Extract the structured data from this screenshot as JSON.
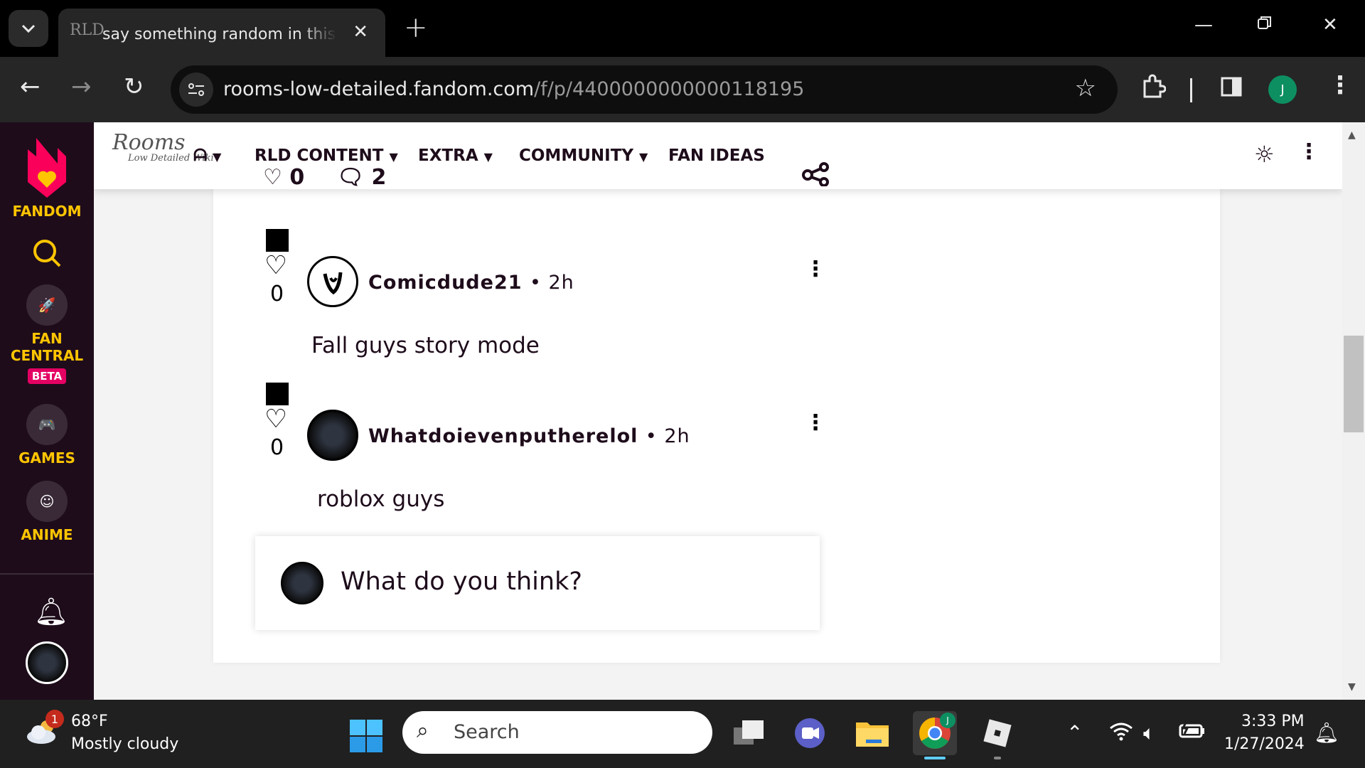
{
  "browser": {
    "tab_title": "say something random in this p",
    "tab_favicon": "RLD",
    "url_host": "rooms-low-detailed.fandom.com",
    "url_path": "/f/p/4400000000000118195",
    "profile_initial": "J"
  },
  "rail": {
    "fandom_label": "FANDOM",
    "fan_central_label_1": "FAN",
    "fan_central_label_2": "CENTRAL",
    "beta_label": "BETA",
    "games_label": "GAMES",
    "anime_label": "ANIME"
  },
  "navbar": {
    "logo_text": "Rooms",
    "logo_sub": "Low Detailed Wiki",
    "items": [
      {
        "label": "RLD CONTENT"
      },
      {
        "label": "EXTRA"
      },
      {
        "label": "COMMUNITY"
      },
      {
        "label": "FAN IDEAS"
      }
    ],
    "likes": "0",
    "replies": "2"
  },
  "replies": [
    {
      "username": "Comicdude21",
      "time": "2h",
      "likes": "0",
      "text": "Fall guys story mode"
    },
    {
      "username": "Whatdoievenputherelol",
      "time": "2h",
      "likes": "0",
      "text": "roblox guys"
    }
  ],
  "composer": {
    "placeholder": "What do you think?"
  },
  "taskbar": {
    "weather_temp": "68°F",
    "weather_desc": "Mostly cloudy",
    "weather_badge": "1",
    "search_placeholder": "Search",
    "chrome_badge": "J",
    "time": "3:33 PM",
    "date": "1/27/2024"
  },
  "colors": {
    "fandom_yellow": "#ffc500",
    "fandom_rail": "#1e0c1b",
    "accent_pink": "#e40063",
    "profile_green": "#0d8f62"
  }
}
